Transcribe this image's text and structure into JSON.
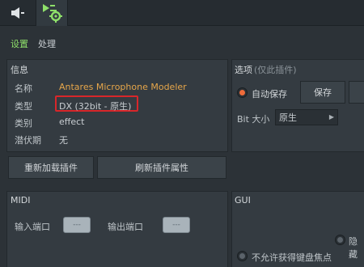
{
  "tabs": {
    "speaker_icon": "speaker-icon",
    "plugin_icon": "plugin-gear-icon"
  },
  "subtabs": {
    "settings": "设置",
    "process": "处理"
  },
  "info": {
    "title": "信息",
    "rows": [
      {
        "label": "名称",
        "value": "Antares Microphone Modeler"
      },
      {
        "label": "类型",
        "value": "DX (32bit - 原生)"
      },
      {
        "label": "类别",
        "value": "effect"
      },
      {
        "label": "潜伏期",
        "value": "无"
      }
    ],
    "reload_button": "重新加载插件",
    "refresh_button": "刷新插件属性"
  },
  "options": {
    "title": "选项",
    "subtitle": "(仅此插件)",
    "autosave_label": "自动保存",
    "save_button": "保存",
    "bit_label": "Bit 大小",
    "bit_value": "原生"
  },
  "midi": {
    "title": "MIDI",
    "input_label": "输入端口",
    "output_label": "输出端口",
    "input_value": "---",
    "output_value": "---"
  },
  "gui": {
    "title": "GUI",
    "hide_label": "隐藏",
    "nofocus_label": "不允许获得键盘焦点"
  },
  "colors": {
    "accent_green": "#8ee06a",
    "name_orange": "#e6a64a",
    "highlight_red": "#d8262a",
    "radio_orange": "#ef6b3a"
  }
}
